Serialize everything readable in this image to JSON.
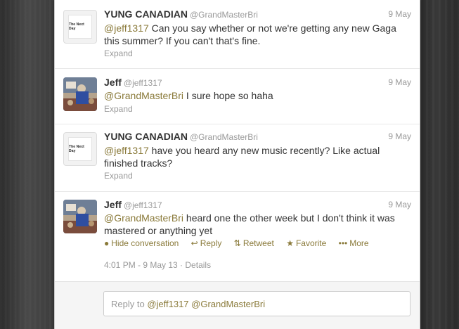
{
  "tweets": [
    {
      "name": "YUNG CANADIAN",
      "handle": "@GrandMasterBri",
      "date": "9 May",
      "mention": "@jeff1317",
      "text": " Can you say whether or not we're getting any new Gaga this summer? If you can't that's fine.",
      "expand": "Expand",
      "avatar_text": "The Next Day"
    },
    {
      "name": "Jeff",
      "handle": "@jeff1317",
      "date": "9 May",
      "mention": "@GrandMasterBri",
      "text": " I sure hope so haha",
      "expand": "Expand"
    },
    {
      "name": "YUNG CANADIAN",
      "handle": "@GrandMasterBri",
      "date": "9 May",
      "mention": "@jeff1317",
      "text": " have you heard any new music recently? Like actual finished tracks?",
      "expand": "Expand",
      "avatar_text": "The Next Day"
    },
    {
      "name": "Jeff",
      "handle": "@jeff1317",
      "date": "9 May",
      "mention": "@GrandMasterBri",
      "text": " heard one the other week but I don't think it was mastered or anything yet",
      "actions": {
        "hide": "Hide conversation",
        "reply": "Reply",
        "retweet": "Retweet",
        "favorite": "Favorite",
        "more": "More"
      },
      "timestamp": "4:01 PM - 9 May 13",
      "details": "Details"
    }
  ],
  "reply_box": {
    "prefix": "Reply to ",
    "mentions": "@jeff1317 @GrandMasterBri"
  },
  "colors": {
    "link": "#8a7a3a",
    "muted": "#999999",
    "text": "#333333"
  }
}
